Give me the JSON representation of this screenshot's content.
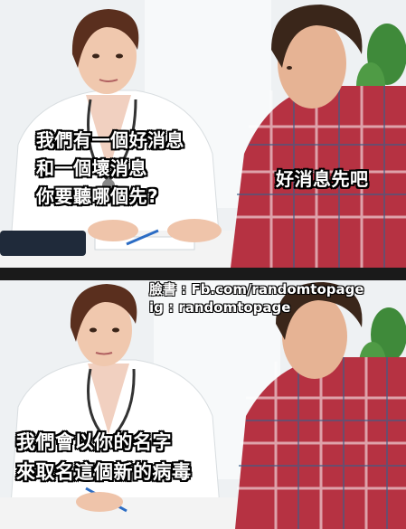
{
  "captions": {
    "doctor_panel1": "我們有一個好消息\n和一個壞消息\n你要聽哪個先?",
    "patient_panel1": "好消息先吧",
    "doctor_panel2": "我們會以你的名字\n來取名這個新的病毒"
  },
  "watermark": {
    "facebook": "臉書 : Fb.com/randomtopage",
    "instagram": "ig : randomtopage"
  }
}
